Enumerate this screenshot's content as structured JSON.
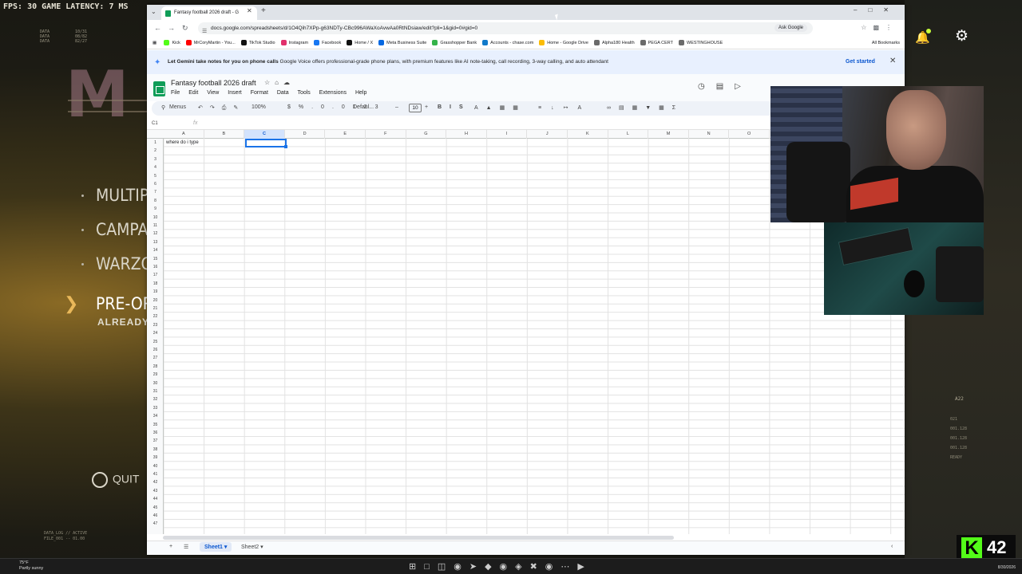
{
  "hud": {
    "fps_line": "FPS:  30 GAME LATENCY:  7 MS",
    "data_a": "DATA\nDATA\nDATA",
    "data_b": "10/31\n08/82\n82/27"
  },
  "game_menu": {
    "items": [
      "MULTIP",
      "CAMPAI",
      "WARZO",
      "PRE-OR"
    ],
    "preorder_sub": "ALREADY",
    "quit": "QUIT"
  },
  "game_right": {
    "label": "A22",
    "stats": [
      "021",
      "001.128",
      "001.128",
      "001.128",
      "READY"
    ]
  },
  "stream": {
    "kick_count": "42"
  },
  "browser": {
    "tab_title": "Fantasy football 2026 draft - G",
    "url": "docs.google.com/spreadsheets/d/1O4Qih7XPp-g63NDTy-CBc996AWaXoAvwAa0RtNDsiaw/edit?pli=1&gid=0#gid=0",
    "ask_google": "Ask Google",
    "bookmarks": [
      "Kick",
      "MrCoryMartin - You...",
      "TikTok Studio",
      "Instagram",
      "Facebook",
      "Home / X",
      "Meta Business Suite",
      "Grasshopper Bank",
      "Accounts - chase.com",
      "Home - Google Drive",
      "Alpha180 Health",
      "PEGA CERT",
      "WESTINGHOUSE"
    ],
    "all_bookmarks": "All Bookmarks",
    "bookmark_colors": [
      "#53fc18",
      "#ff0000",
      "#111111",
      "#e1306c",
      "#1877f2",
      "#111111",
      "#0668e1",
      "#35b34a",
      "#117aca",
      "#fbbc04",
      "#6b6b6b",
      "#6b6b6b",
      "#6b6b6b"
    ]
  },
  "banner": {
    "bold": "Let Gemini take notes for you on phone calls",
    "text": " Google Voice offers professional-grade phone plans, with premium features like AI note-taking, call recording, 3-way calling, and auto attendant",
    "cta": "Get started"
  },
  "sheet": {
    "title": "Fantasy football 2026 draft",
    "menus": [
      "File",
      "Edit",
      "View",
      "Insert",
      "Format",
      "Data",
      "Tools",
      "Extensions",
      "Help"
    ],
    "menus_search": "Menus",
    "zoom": "100%",
    "font": "Defaul...",
    "font_size": "10",
    "name_box": "C1",
    "fx": "fx",
    "columns": [
      "A",
      "B",
      "C",
      "D",
      "E",
      "F",
      "G",
      "H",
      "I",
      "J",
      "K",
      "L",
      "M",
      "N",
      "O"
    ],
    "selected_column": "C",
    "row_count": 47,
    "cell_a1": "where do i type",
    "tabs": [
      "Sheet1",
      "Sheet2"
    ]
  },
  "taskbar": {
    "weather_temp": "75°F",
    "weather_desc": "Partly sunny",
    "date": "8/30/2026"
  }
}
